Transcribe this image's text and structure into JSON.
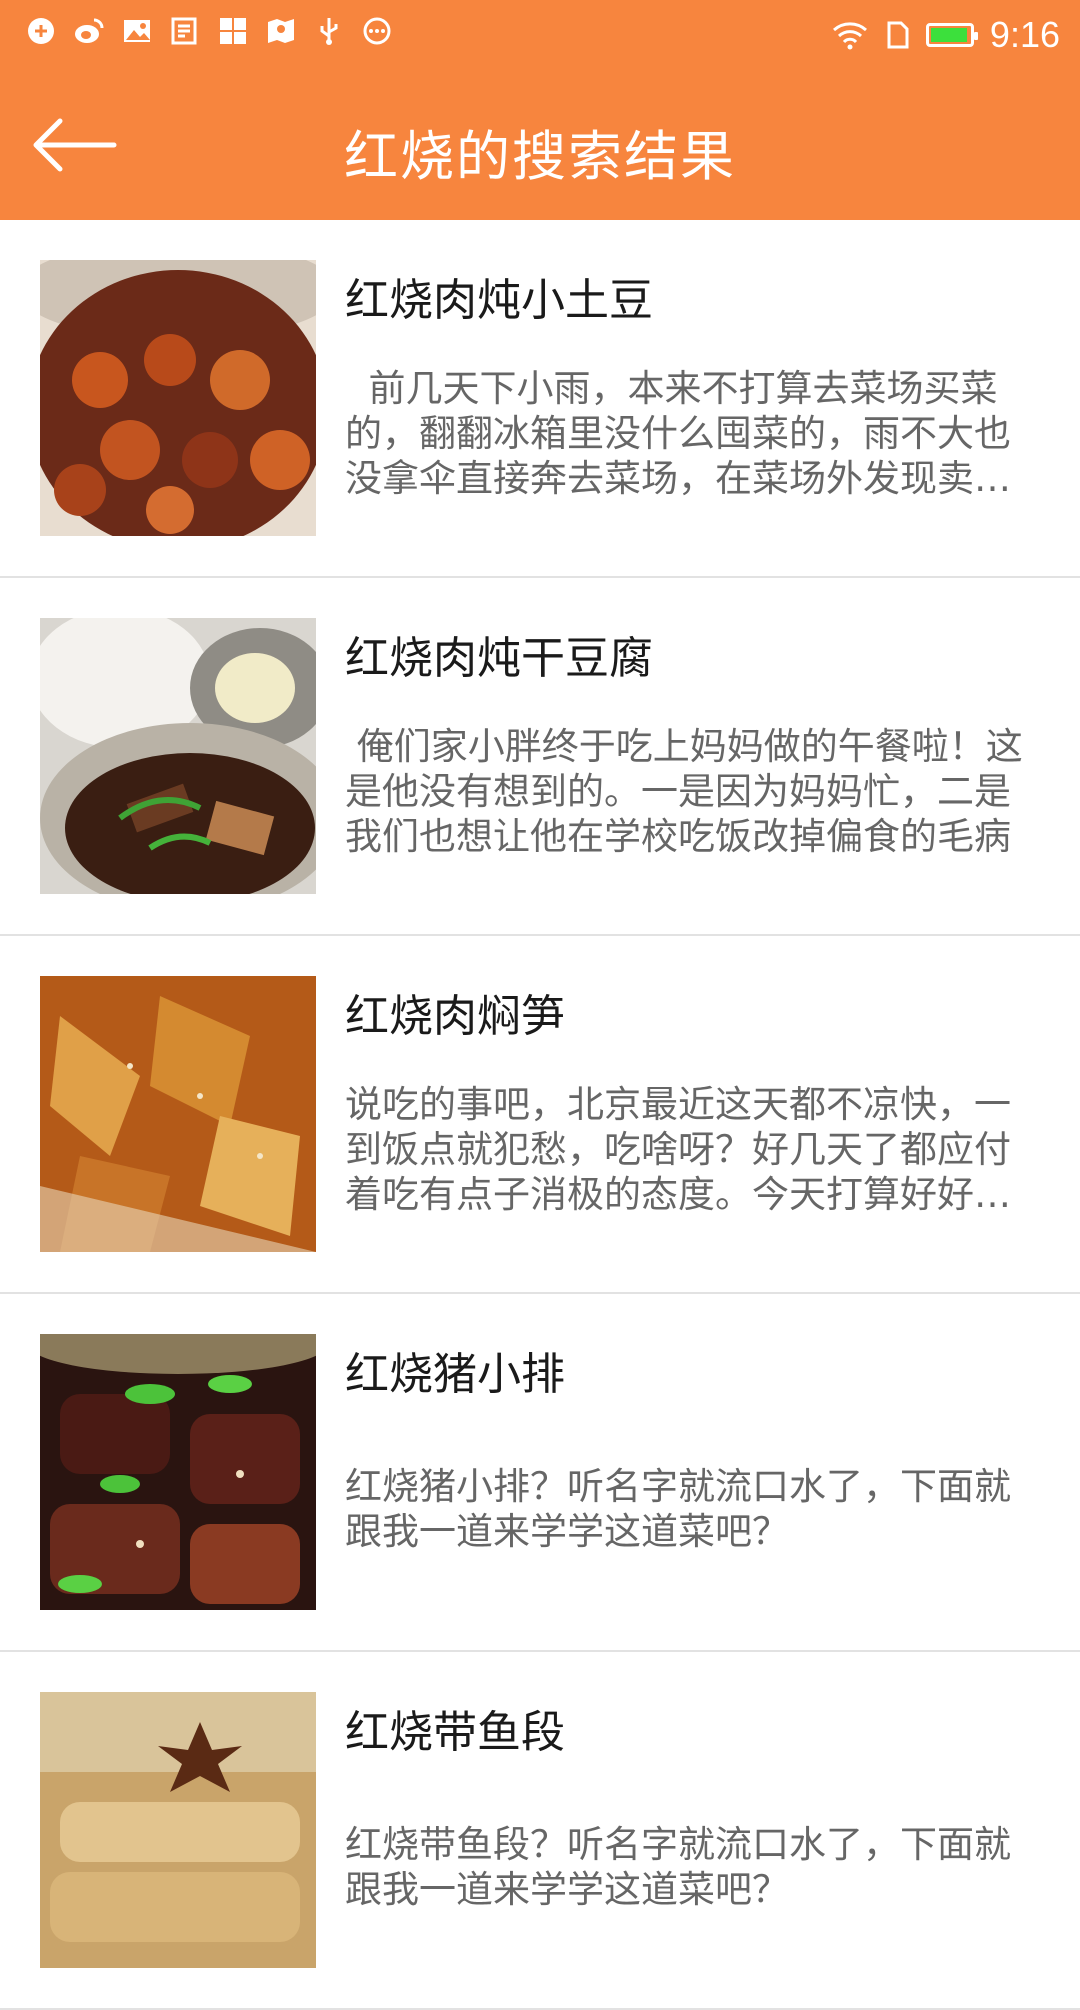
{
  "status_bar": {
    "time": "9:16",
    "battery_level": 0.95,
    "left_icons": [
      "app-notify-icon",
      "weibo-icon",
      "image-icon",
      "note-icon",
      "grid-app-icon",
      "map-pin-icon",
      "usb-icon",
      "more-icon"
    ],
    "right_icons": [
      "wifi-icon",
      "sim-icon",
      "battery-icon"
    ]
  },
  "header": {
    "title": "红烧的搜索结果",
    "back_icon": "arrow-left-icon"
  },
  "colors": {
    "header_bg": "#F7853E",
    "title_text": "#1a1a1a",
    "desc_text": "#666666",
    "divider": "#E2E2E2"
  },
  "results": [
    {
      "title": "红烧肉炖小土豆",
      "desc": "  前几天下小雨，本来不打算去菜场买菜的，翻翻冰箱里没什么囤菜的，雨不大也没拿伞直接奔去菜场，在菜场外发现卖小土豆的，小土豆好好吃"
    },
    {
      "title": "红烧肉炖干豆腐",
      "desc": " 俺们家小胖终于吃上妈妈做的午餐啦！这是他没有想到的。一是因为妈妈忙，二是我们也想让他在学校吃饭改掉偏食的毛病"
    },
    {
      "title": "红烧肉焖笋",
      "desc": "说吃的事吧，北京最近这天都不凉快，一到饭点就犯愁，吃啥呀？好几天了都应付着吃有点子消极的态度。今天打算好好做一顿"
    },
    {
      "title": "红烧猪小排",
      "desc": "红烧猪小排？听名字就流口水了，下面就跟我一道来学学这道菜吧？"
    },
    {
      "title": "红烧带鱼段",
      "desc": "红烧带鱼段？听名字就流口水了，下面就跟我一道来学学这道菜吧？"
    }
  ]
}
